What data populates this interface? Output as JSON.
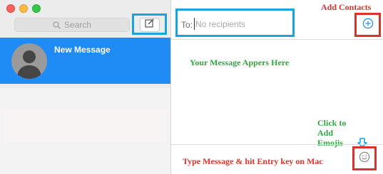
{
  "sidebar": {
    "search_placeholder": "Search",
    "conversation": {
      "title": "New Message"
    }
  },
  "compose": {
    "to_label": "To:",
    "recipients_placeholder": "No recipients"
  },
  "annotations": {
    "add_contacts": "Add Contacts",
    "message_area": "Your Message Appers Here",
    "emoji_hint": "Click to Add Emojis",
    "type_message": "Type Message & hit Entry key on Mac"
  },
  "icons": {
    "compose": "compose-icon",
    "search": "search-icon",
    "add_contact": "plus-circle-icon",
    "emoji": "smiley-icon",
    "avatar": "person-silhouette-icon"
  },
  "colors": {
    "selection_blue": "#1f8cf5",
    "highlight_blue": "#1aa3df",
    "highlight_red": "#d9342b",
    "annotation_green": "#32a542"
  }
}
